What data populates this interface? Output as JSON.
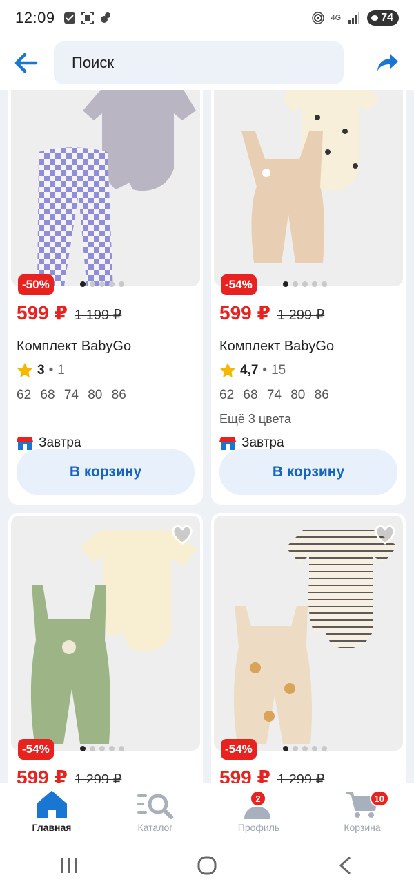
{
  "status_bar": {
    "time": "12:09",
    "network": "4G",
    "battery": "74",
    "icons": [
      "checkbox-icon",
      "screenshot-icon",
      "squirrel-icon",
      "hotspot-icon",
      "signal-icon"
    ]
  },
  "header": {
    "search_placeholder": "Поиск",
    "icons": [
      "back-arrow-icon",
      "share-icon"
    ],
    "accent": "#1976d2"
  },
  "products": [
    {
      "discount": "-50%",
      "price": "599 ₽",
      "old_price": "1 199 ₽",
      "title": "Комплект BabyGo",
      "rating": "3",
      "reviews": "1",
      "sizes": "62 68 74 80 86",
      "colors_note": "",
      "delivery": "Завтра",
      "cart_label": "В корзину"
    },
    {
      "discount": "-54%",
      "price": "599 ₽",
      "old_price": "1 299 ₽",
      "title": "Комплект BabyGo",
      "rating": "4,7",
      "reviews": "15",
      "sizes": "62 68 74 80 86",
      "colors_note": "Ещё 3 цвета",
      "delivery": "Завтра",
      "cart_label": "В корзину"
    },
    {
      "discount": "-54%",
      "price": "599 ₽",
      "old_price": "1 299 ₽"
    },
    {
      "discount": "-54%",
      "price": "599 ₽",
      "old_price": "1 299 ₽"
    }
  ],
  "tabbar": [
    {
      "label": "Главная",
      "icon": "home-icon",
      "active": true
    },
    {
      "label": "Каталог",
      "icon": "catalog-search-icon"
    },
    {
      "label": "Профиль",
      "icon": "profile-icon",
      "badge": "2"
    },
    {
      "label": "Корзина",
      "icon": "cart-icon",
      "badge": "10"
    }
  ],
  "colors": {
    "discount": "#e8231f",
    "button_text": "#1565c0",
    "button_bg": "#e7f0fb"
  }
}
